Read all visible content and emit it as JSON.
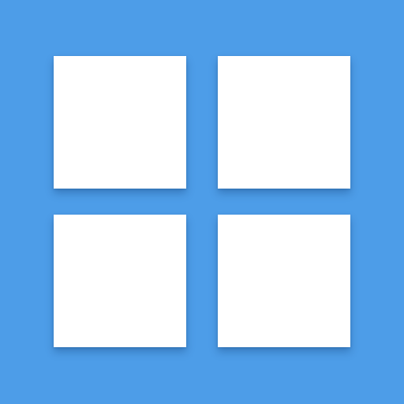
{
  "icon": {
    "name": "grid-icon",
    "background_color": "#4d9de8",
    "tile_color": "#ffffff",
    "tiles": [
      {
        "name": "tile-top-left"
      },
      {
        "name": "tile-top-right"
      },
      {
        "name": "tile-bottom-left"
      },
      {
        "name": "tile-bottom-right"
      }
    ]
  }
}
